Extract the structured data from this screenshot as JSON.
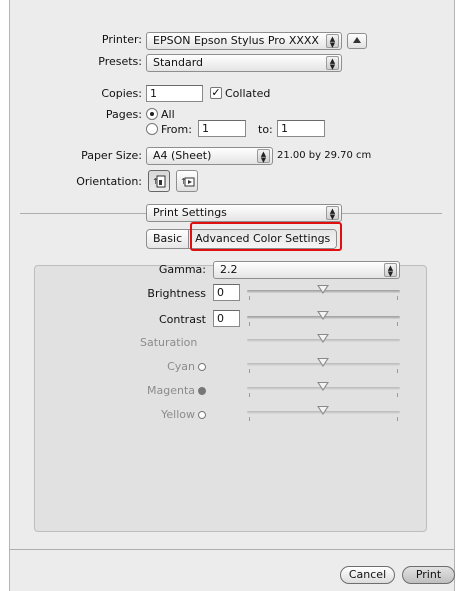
{
  "printer": {
    "label": "Printer:",
    "value": "EPSON Epson Stylus Pro XXXX"
  },
  "presets": {
    "label": "Presets:",
    "value": "Standard"
  },
  "copies": {
    "label": "Copies:",
    "value": "1",
    "collated_label": "Collated",
    "collated_checked": true
  },
  "pages": {
    "label": "Pages:",
    "all_label": "All",
    "from_label": "From:",
    "from_value": "1",
    "to_label": "to:",
    "to_value": "1",
    "selected": "All"
  },
  "paper_size": {
    "label": "Paper Size:",
    "value": "A4 (Sheet)",
    "dimensions": "21.00 by 29.70 cm"
  },
  "orientation": {
    "label": "Orientation:",
    "selected": "portrait"
  },
  "panel_menu": {
    "value": "Print Settings"
  },
  "tabs": [
    {
      "label": "Basic"
    },
    {
      "label": "Advanced Color Settings"
    }
  ],
  "active_tab": "Advanced Color Settings",
  "gamma": {
    "label": "Gamma:",
    "value": "2.2"
  },
  "brightness": {
    "label": "Brightness",
    "value": "0"
  },
  "contrast": {
    "label": "Contrast",
    "value": "0"
  },
  "saturation": {
    "label": "Saturation"
  },
  "cyan": {
    "label": "Cyan"
  },
  "magenta": {
    "label": "Magenta"
  },
  "yellow": {
    "label": "Yellow"
  },
  "buttons": {
    "cancel": "Cancel",
    "print": "Print"
  },
  "colors": {
    "highlight_border": "#e01010"
  }
}
